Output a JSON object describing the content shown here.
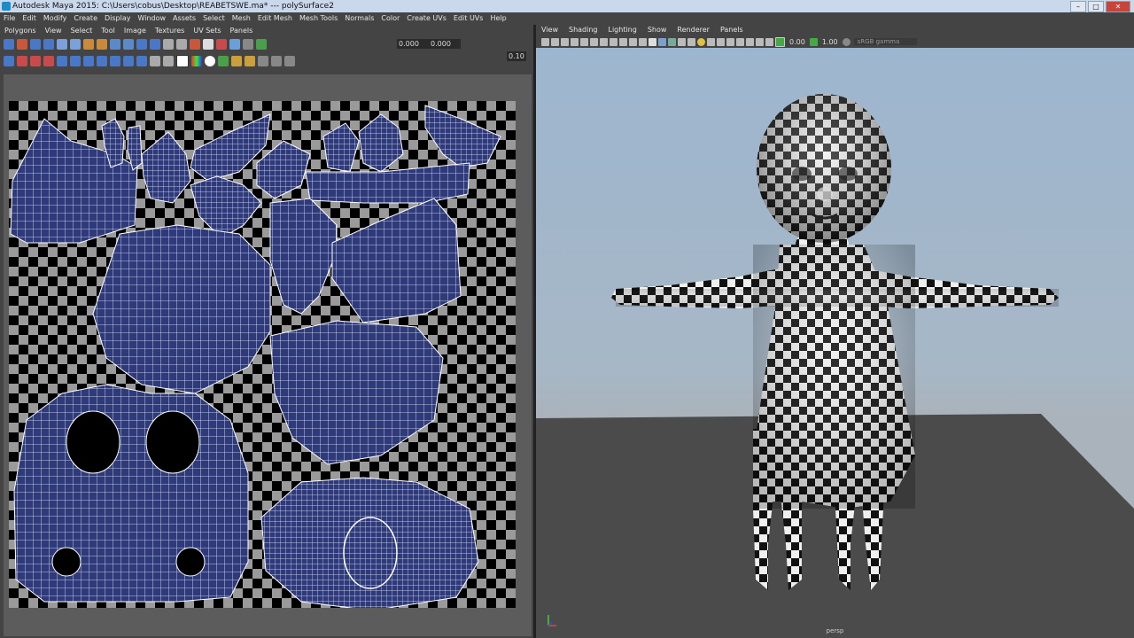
{
  "window": {
    "title": "Autodesk Maya 2015: C:\\Users\\cobus\\Desktop\\REABETSWE.ma*   ---   polySurface2"
  },
  "main_menu": [
    "File",
    "Edit",
    "Modify",
    "Create",
    "Display",
    "Window",
    "Assets",
    "Select",
    "Mesh",
    "Edit Mesh",
    "Mesh Tools",
    "Normals",
    "Color",
    "Create UVs",
    "Edit UVs",
    "Help"
  ],
  "uv_editor": {
    "menu": [
      "Polygons",
      "View",
      "Select",
      "Tool",
      "Image",
      "Textures",
      "UV Sets",
      "Panels"
    ],
    "u_value": "0.000",
    "v_value": "0.000",
    "increment": "0.10"
  },
  "viewport": {
    "menu": [
      "View",
      "Shading",
      "Lighting",
      "Show",
      "Renderer",
      "Panels"
    ],
    "exposure": "0.00",
    "gamma": "1.00",
    "color_space": "sRGB gamma",
    "camera_label": "persp"
  },
  "colors": {
    "uv_shell_fill": "#2f3a7a",
    "uv_wire": "#ffffff",
    "sky_top": "#9db6cf",
    "floor": "#4b4b4b"
  }
}
